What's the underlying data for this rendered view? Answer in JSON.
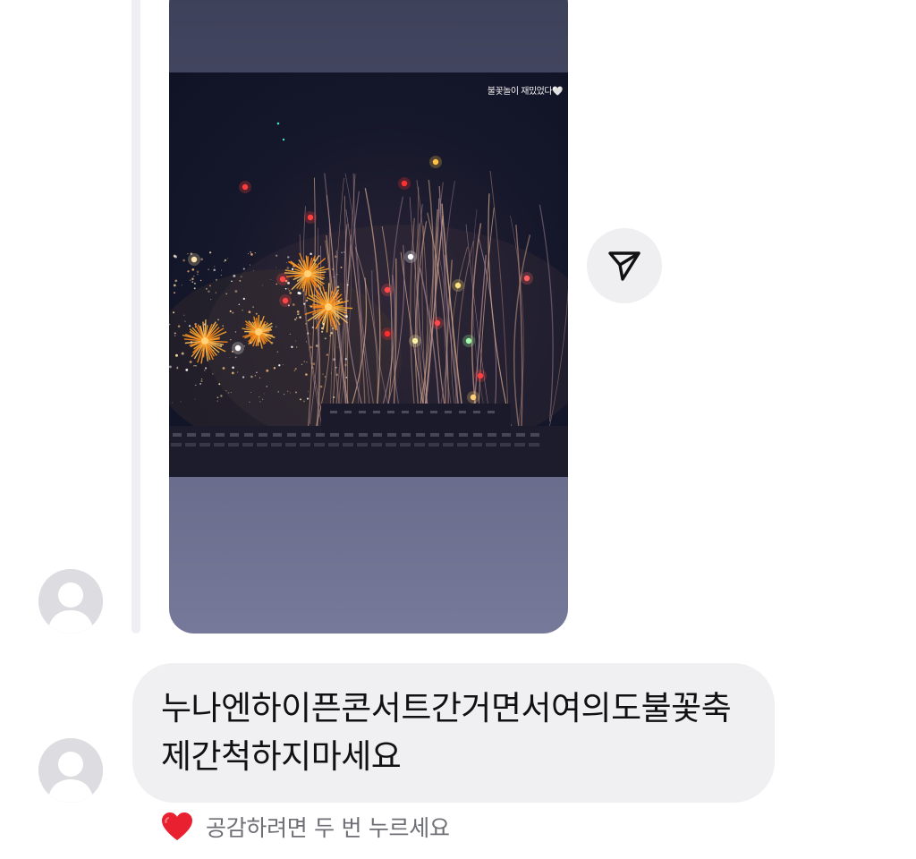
{
  "story": {
    "caption": "불꽃놀이 재밌었다🤍",
    "image_icon": "fireworks-photo",
    "share_icon": "paper-plane-icon"
  },
  "thread": {
    "avatar_icon": "default-profile-avatar",
    "message_text": "누나엔하이픈콘서트간거면서여의도불꽃축제간척하지마세요"
  },
  "reaction_hint": {
    "icon": "heart-icon",
    "text": "공감하려면 두 번 누르세요"
  },
  "colors": {
    "bubble_background": "#f0f0f3",
    "heart": "#e8202f",
    "hint_text": "#6e6e75"
  }
}
